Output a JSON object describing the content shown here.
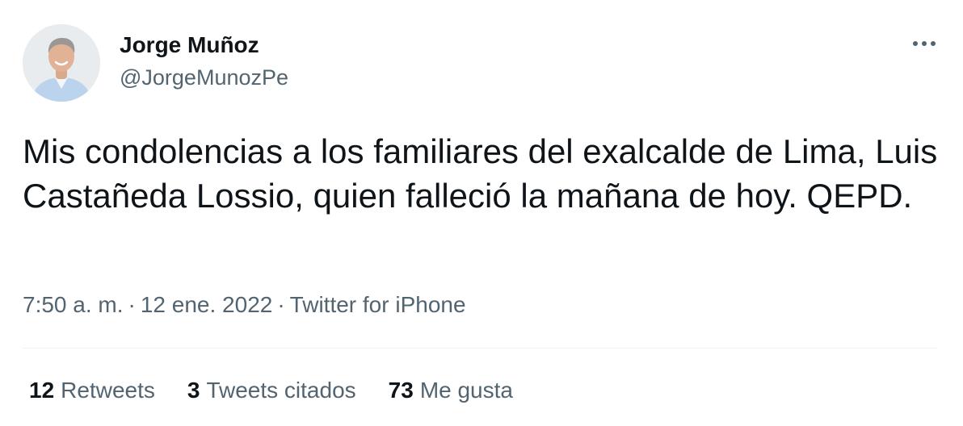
{
  "author": {
    "display_name": "Jorge Muñoz",
    "handle": "@JorgeMunozPe",
    "avatar_icon": "profile-photo"
  },
  "tweet": {
    "text": "Mis condolencias a los familiares del exalcalde de Lima, Luis Castañeda Lossio, quien falleció la mañana de hoy. QEPD."
  },
  "meta": {
    "time": "7:50 a. m.",
    "separator": "·",
    "date": "12 ene. 2022",
    "source": "Twitter for iPhone"
  },
  "stats": [
    {
      "count": "12",
      "label": "Retweets"
    },
    {
      "count": "3",
      "label": "Tweets citados"
    },
    {
      "count": "73",
      "label": "Me gusta"
    }
  ],
  "colors": {
    "primary_text": "#0f1419",
    "secondary_text": "#536471",
    "divider": "#eff3f4"
  },
  "icons": {
    "more": "more-horizontal-icon"
  }
}
